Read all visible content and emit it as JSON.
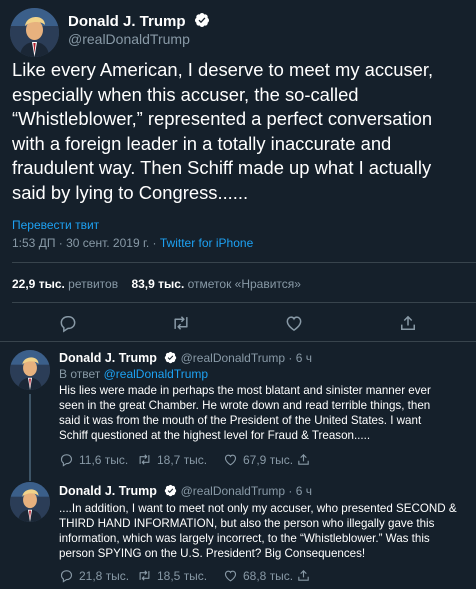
{
  "main_tweet": {
    "author_name": "Donald J. Trump",
    "author_handle": "@realDonaldTrump",
    "text_lines": [
      "Like every American, I deserve to meet my accuser,",
      "especially when this accuser, the so-called",
      "“Whistleblower,” represented a perfect conversation",
      "with a foreign leader in a totally inaccurate and",
      "fraudulent way. Then Schiff made up what I actually",
      "said by lying to Congress......"
    ],
    "translate_label": "Перевести твит",
    "timestamp": "1:53 ДП · 30 сент. 2019 г. · ",
    "source": "Twitter for iPhone",
    "retweets_count": "22,9 тыс.",
    "retweets_label": " ретвитов",
    "likes_count": "83,9 тыс.",
    "likes_label": " отметок «Нравится»"
  },
  "replies": [
    {
      "author_name": "Donald J. Trump",
      "author_handle": "@realDonaldTrump",
      "age": " · 6 ч",
      "reply_to_prefix": "В ответ ",
      "reply_to_handle": "@realDonaldTrump",
      "text_lines": [
        "His lies were made in perhaps the most blatant and sinister manner ever",
        "seen in the great Chamber. He wrote down and read terrible things, then",
        "said it was from the mouth of the President of the United States. I want",
        "Schiff questioned at the highest level for Fraud & Treason....."
      ],
      "reply_count": "11,6 тыс.",
      "retweet_count": "18,7 тыс.",
      "like_count": "67,9 тыс."
    },
    {
      "author_name": "Donald J. Trump",
      "author_handle": "@realDonaldTrump",
      "age": " · 6 ч",
      "text_lines": [
        "....In addition, I want to meet not only my accuser, who presented SECOND &",
        "THIRD HAND INFORMATION, but also the person who illegally gave this",
        "information, which was largely incorrect, to the “Whistleblower.” Was this",
        "person SPYING on the U.S. President? Big Consequences!"
      ],
      "reply_count": "21,8 тыс.",
      "retweet_count": "18,5 тыс.",
      "like_count": "68,8 тыс."
    }
  ],
  "icons": {
    "verified": "verified-badge-icon",
    "reply": "reply-icon",
    "retweet": "retweet-icon",
    "like": "like-icon",
    "share": "share-icon"
  },
  "colors": {
    "background": "#15202b",
    "accent": "#1da1f2",
    "muted": "#8899a6",
    "divider": "#38444d"
  }
}
